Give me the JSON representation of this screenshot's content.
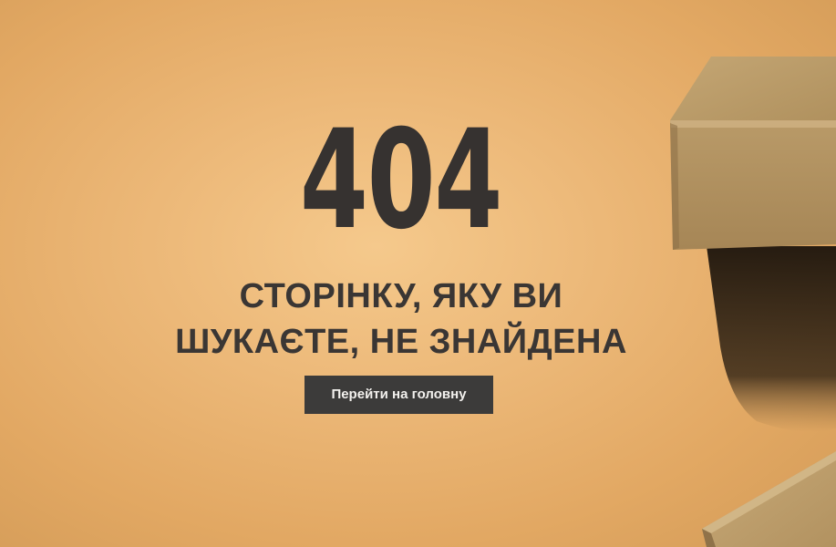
{
  "error": {
    "code": "404",
    "message_line1": "СТОРІНКУ, ЯКУ ВИ",
    "message_line2": "ШУКАЄТЕ, НЕ ЗНАЙДЕНА"
  },
  "actions": {
    "home_button_label": "Перейти на головну"
  },
  "colors": {
    "background": "#ecb878",
    "text": "#363230",
    "button_bg": "#3c3b3a",
    "button_text": "#f3f1ee",
    "box": "#b89968"
  },
  "icons": {
    "box_top": "cardboard-box-illustration",
    "box_bottom": "cardboard-box-corner-illustration"
  }
}
